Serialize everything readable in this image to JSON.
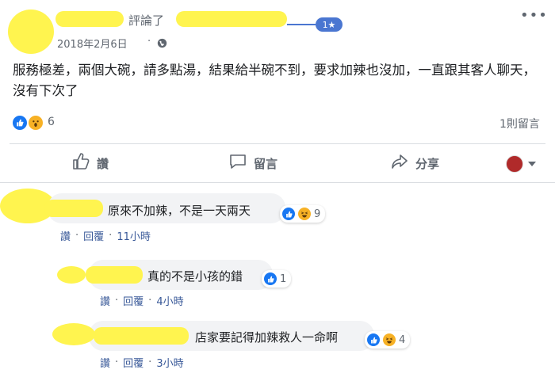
{
  "post": {
    "action_text": "評論了",
    "badge": "1★",
    "date": "2018年2月6日",
    "dot": "·",
    "text": "服務極差，兩個大碗，請多點湯，結果給半碗不到，要求加辣也沒加，一直跟其客人聊天，沒有下次了",
    "reaction_count": "6",
    "comments_count": "1則留言"
  },
  "actions": {
    "like": "讚",
    "comment": "留言",
    "share": "分享"
  },
  "comments": [
    {
      "text": "原來不加辣，不是一天兩天",
      "count": "9",
      "like": "讚",
      "reply": "回覆",
      "time": "11小時"
    },
    {
      "text": "真的不是小孩的錯",
      "count": "1",
      "like": "讚",
      "reply": "回覆",
      "time": "4小時"
    },
    {
      "text": "店家要記得加辣救人一命啊",
      "count": "4",
      "like": "讚",
      "reply": "回覆",
      "time": "3小時"
    }
  ],
  "meta_sep": "·",
  "colors": {
    "highlight": "#fff44f",
    "like_blue": "#1877f2",
    "link": "#385898"
  }
}
